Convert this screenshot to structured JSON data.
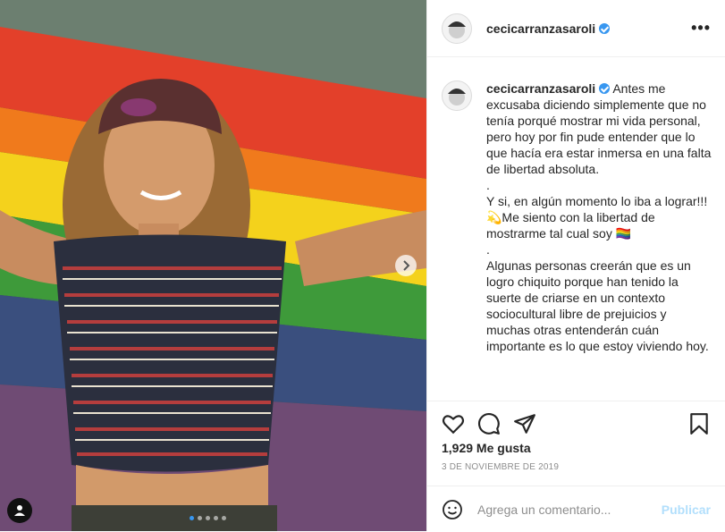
{
  "post": {
    "username": "cecicarranzasaroli",
    "more_label": "•••",
    "caption_lines": [
      "Antes me excusaba diciendo simplemente que no tenía porqué mostrar mi vida personal, pero hoy por fin pude entender que lo que hacía era estar inmersa en una falta de libertad absoluta.",
      ".",
      "Y si, en algún momento lo iba a lograr!!! 💫Me siento con la libertad de mostrarme tal cual soy 🏳️‍🌈",
      ".",
      "Algunas personas creerán que es un logro chiquito porque han tenido la suerte de criarse en un contexto sociocultural libre de prejuicios y muchas otras entenderán cuán importante es lo que estoy viviendo hoy."
    ],
    "likes": "1,929 Me gusta",
    "date": "3 DE NOVIEMBRE DE 2019",
    "comment_placeholder": "Agrega un comentario...",
    "publish_label": "Publicar",
    "carousel": {
      "slides": 5,
      "active": 1
    }
  },
  "icons": {
    "like": "heart-icon",
    "comment": "comment-icon",
    "share": "paper-plane-icon",
    "save": "bookmark-icon",
    "emoji": "smiley-icon",
    "next": "chevron-right-icon",
    "tag": "user-tag-icon"
  },
  "colors": {
    "accent": "#3897f0",
    "publish_disabled": "#b2dffc",
    "muted": "#8e8e8e"
  }
}
